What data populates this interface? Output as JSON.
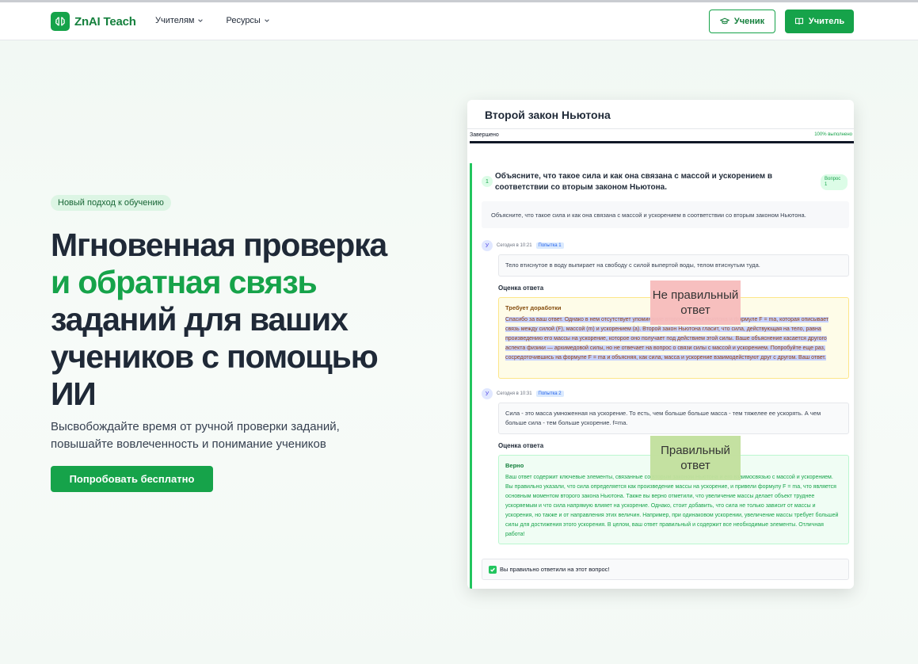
{
  "brand": {
    "name": "ZnAI Teach"
  },
  "nav": {
    "items": [
      {
        "label": "Учителям"
      },
      {
        "label": "Ресурсы"
      }
    ],
    "student_btn": "Ученик",
    "teacher_btn": "Учитель"
  },
  "hero": {
    "badge": "Новый подход к обучению",
    "title_line1": "Мгновенная проверка",
    "title_line2": "и обратная связь",
    "title_line3": "заданий для ваших",
    "title_line4": "учеников с помощью",
    "title_line5": "ИИ",
    "subtitle_line1": "Высвобождайте время от ручной проверки заданий,",
    "subtitle_line2": "повышайте вовлеченность и понимание учеников",
    "cta": "Попробовать бесплатно"
  },
  "card": {
    "title": "Второй закон Ньютона",
    "progress_label": "Завершено",
    "progress_pct_text": "100% выполнено",
    "progress_value": 1.0,
    "question": {
      "number": "1",
      "text": "Объясните, что такое сила и как она связана с массой и ускорением в соответствии со вторым законом Ньютона.",
      "pill": "Вопрос 1",
      "box_text": "Объясните, что такое сила и как она связана с массой и ускорением в соответствии со вторым законом Ньютона."
    },
    "attempts": [
      {
        "avatar": "У",
        "time": "Сегодня в 10:21",
        "tag": "Попытка 1",
        "answer": "Тело втиснутое в воду выпирает на свободу с силой выпертой воды, телом втиснутым туда.",
        "eval_label": "Оценка ответа",
        "feedback_title": "Требует доработки",
        "feedback_text": "Спасибо за ваш ответ. Однако в нем отсутствует упоминание второго закона Ньютона и формуле F = ma, которая описывает связь между силой (F), массой (m) и ускорением (a). Второй закон Ньютона гласит, что сила, действующая на тело, равна произведению его массы на ускорение, которое оно получает под действием этой силы. Ваше объяснение касается другого аспекта физики — архимедовой силы, но не отвечает на вопрос о связи силы с массой и ускорением. Попробуйте еще раз, сосредоточившись на формуле F = ma и объясняя, как сила, масса и ускорение взаимодействуют друг с другом. Ваш ответ."
      },
      {
        "avatar": "У",
        "time": "Сегодня в 10:31",
        "tag": "Попытка 2",
        "answer": "Сила - это масса умноженная на ускорение. То есть, чем больше больше масса - тем тяжелее ее ускорять. А чем больше сила - тем больше ускорение. f=ma.",
        "eval_label": "Оценка ответа",
        "feedback_title": "Верно",
        "feedback_text": "Ваш ответ содержит ключевые элементы, связанные со вторым законом Ньютона и его взаимосвязью с массой и ускорением. Вы правильно указали, что сила определяется как произведение массы на ускорение, и привели формулу F = ma, что является основным моментом второго закона Ньютона. Также вы верно отметили, что увеличение массы делает объект труднее ускоряемым и что сила напрямую влияет на ускорение. Однако, стоит добавить, что сила не только зависит от массы и ускорения, но также и от направления этих величин. Например, при одинаковом ускорении, увеличение массы требует большей силы для достижения этого ускорения. В целом, ваш ответ правильный и содержит все необходимые элементы. Отличная работа!"
      }
    ],
    "result": "Вы правильно ответили на этот вопрос!"
  },
  "annotations": {
    "wrong": "Не правильный ответ",
    "right": "Правильный ответ"
  },
  "colors": {
    "brand_green": "#16a34a",
    "note_wrong": "#f7bcbc",
    "note_right": "#c2e09d"
  }
}
